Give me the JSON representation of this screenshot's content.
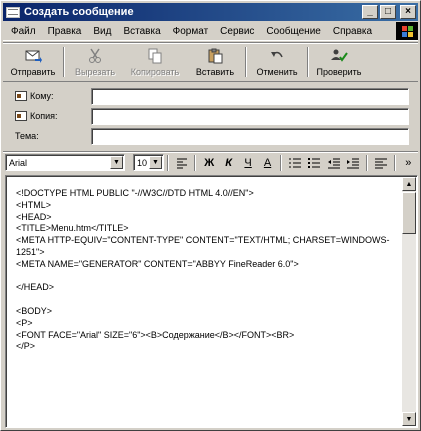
{
  "window": {
    "title": "Создать сообщение",
    "controls": {
      "minimize": "_",
      "maximize": "□",
      "close": "×"
    }
  },
  "menu": [
    "Файл",
    "Правка",
    "Вид",
    "Вставка",
    "Формат",
    "Сервис",
    "Сообщение",
    "Справка"
  ],
  "toolbar": {
    "send": "Отправить",
    "cut": "Вырезать",
    "copy": "Копировать",
    "paste": "Вставить",
    "undo": "Отменить",
    "check": "Проверить"
  },
  "headers": {
    "to_label": "Кому:",
    "cc_label": "Копия:",
    "subject_label": "Тема:",
    "to_value": "",
    "cc_value": "",
    "subject_value": ""
  },
  "format": {
    "font": "Arial",
    "size": "10",
    "bold": "Ж",
    "italic": "К",
    "underline": "Ч",
    "font_color": "A"
  },
  "body": {
    "source": "<!DOCTYPE HTML PUBLIC \"-//W3C//DTD HTML 4.0//EN\">\n<HTML>\n<HEAD>\n<TITLE>Menu.htm</TITLE>\n<META HTTP-EQUIV=\"CONTENT-TYPE\" CONTENT=\"TEXT/HTML; CHARSET=WINDOWS-1251\">\n<META NAME=\"GENERATOR\" CONTENT=\"ABBYY FineReader 6.0\">\n\n</HEAD>\n\n<BODY>\n<P>\n<FONT FACE=\"Arial\" SIZE=\"6\"><B>Содержание</B></FONT><BR>\n</P>"
  },
  "colors": {
    "title_start": "#0a246a",
    "title_end": "#3a6ea5",
    "face": "#d4d0c8"
  }
}
